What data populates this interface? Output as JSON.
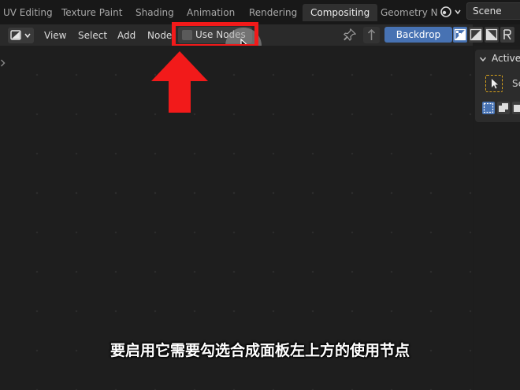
{
  "workspaces": {
    "tabs": [
      {
        "label": "UV Editing",
        "active": false
      },
      {
        "label": "Texture Paint",
        "active": false
      },
      {
        "label": "Shading",
        "active": false
      },
      {
        "label": "Animation",
        "active": false
      },
      {
        "label": "Rendering",
        "active": false
      },
      {
        "label": "Compositing",
        "active": true
      },
      {
        "label": "Geometry N",
        "active": false
      }
    ],
    "scene_icon": "scene-icon",
    "scene_name": "Scene"
  },
  "header": {
    "editor_type_icon": "compositor-icon",
    "menus": [
      "View",
      "Select",
      "Add",
      "Node"
    ],
    "use_nodes": {
      "label": "Use Nodes",
      "checked": false
    },
    "pin_icon": "pin-icon",
    "parent_icon": "arrow-up-icon",
    "backdrop_label": "Backdrop",
    "channel_icons": [
      "color-alpha-icon",
      "color-icon",
      "alpha-icon",
      "channel-r-icon"
    ]
  },
  "sidebar": {
    "panel_title": "Active",
    "tool_label": "Se",
    "tool_icon": "select-box-icon",
    "mode_icons": [
      "mode-new-icon",
      "mode-extend-icon",
      "mode-subtract-icon"
    ]
  },
  "overlay": {
    "subtitle": "要启用它需要勾选合成面板左上方的使用节点",
    "highlight_color": "#f21a1a"
  },
  "colors": {
    "accent": "#4772b3",
    "background": "#1d1d1d"
  }
}
